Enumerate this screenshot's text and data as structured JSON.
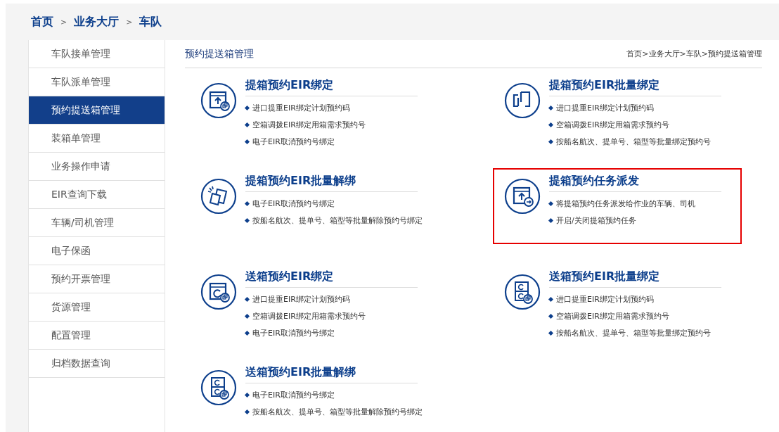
{
  "breadcrumb": {
    "items": [
      "首页",
      "业务大厅",
      "车队"
    ],
    "separator": ">"
  },
  "sidebar": {
    "items": [
      {
        "label": "车队接单管理",
        "selected": false
      },
      {
        "label": "车队派单管理",
        "selected": false
      },
      {
        "label": "预约提送箱管理",
        "selected": true
      },
      {
        "label": "装箱单管理",
        "selected": false
      },
      {
        "label": "业务操作申请",
        "selected": false
      },
      {
        "label": "EIR查询下载",
        "selected": false
      },
      {
        "label": "车辆/司机管理",
        "selected": false
      },
      {
        "label": "电子保函",
        "selected": false
      },
      {
        "label": "预约开票管理",
        "selected": false
      },
      {
        "label": "货源管理",
        "selected": false
      },
      {
        "label": "配置管理",
        "selected": false
      },
      {
        "label": "归档数据查询",
        "selected": false
      }
    ]
  },
  "panel": {
    "title": "预约提送箱管理",
    "path": "首页>业务大厅>车队>预约提送箱管理"
  },
  "cards": [
    {
      "title": "提箱预约EIR绑定",
      "highlighted": false,
      "bullets": [
        "进口提重EIR绑定计划预约码",
        "空箱调拨EIR绑定用箱需求预约号",
        "电子EIR取消预约号绑定"
      ]
    },
    {
      "title": "提箱预约EIR批量绑定",
      "highlighted": false,
      "bullets": [
        "进口提重EIR绑定计划预约码",
        "空箱调拨EIR绑定用箱需求预约号",
        "按船名航次、提单号、箱型等批量绑定预约号"
      ]
    },
    {
      "title": "提箱预约EIR批量解绑",
      "highlighted": false,
      "bullets": [
        "电子EIR取消预约号绑定",
        "按船名航次、提单号、箱型等批量解除预约号绑定"
      ]
    },
    {
      "title": "提箱预约任务派发",
      "highlighted": true,
      "bullets": [
        "将提箱预约任务派发给作业的车辆、司机",
        "开启/关闭提箱预约任务"
      ]
    },
    {
      "title": "送箱预约EIR绑定",
      "highlighted": false,
      "bullets": [
        "进口提重EIR绑定计划预约码",
        "空箱调拨EIR绑定用箱需求预约号",
        "电子EIR取消预约号绑定"
      ]
    },
    {
      "title": "送箱预约EIR批量绑定",
      "highlighted": false,
      "bullets": [
        "进口提重EIR绑定计划预约码",
        "空箱调拨EIR绑定用箱需求预约号",
        "按船名航次、提单号、箱型等批量绑定预约号"
      ]
    },
    {
      "title": "送箱预约EIR批量解绑",
      "highlighted": false,
      "bullets": [
        "电子EIR取消预约号绑定",
        "按船名航次、提单号、箱型等批量解除预约号绑定"
      ]
    }
  ]
}
